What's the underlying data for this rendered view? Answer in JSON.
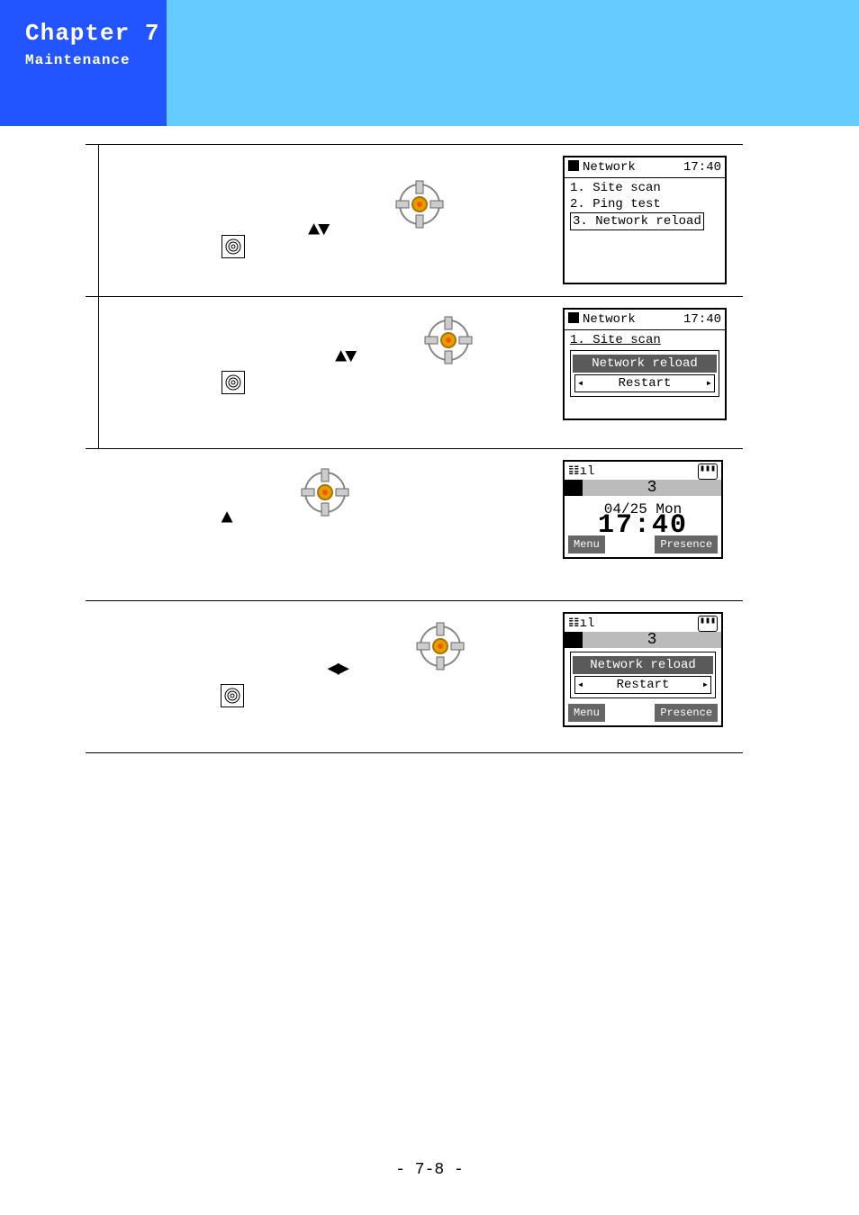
{
  "header": {
    "chapter": "Chapter 7",
    "subtitle": "Maintenance"
  },
  "footer": {
    "page_label": "- 7-8 -"
  },
  "rows": [
    {
      "arrows_glyph": "▲▼",
      "has_menu_key": true,
      "screen": {
        "type": "menu",
        "title": "Network",
        "time": "17:40",
        "items": [
          "1. Site scan",
          "2. Ping test",
          "3. Network reload"
        ],
        "selected_index": 2
      }
    },
    {
      "arrows_glyph": "▲▼",
      "has_menu_key": true,
      "screen": {
        "type": "confirm",
        "title": "Network",
        "time": "17:40",
        "header_item": "1. Site scan",
        "highlight": "Network reload",
        "nav_label": "Restart"
      }
    },
    {
      "arrows_glyph": "▲",
      "has_menu_key": false,
      "screen": {
        "type": "standby",
        "digit": "3",
        "date": "04/25 Mon",
        "time": "17:40",
        "soft_left": "Menu",
        "soft_right": "Presence"
      }
    },
    {
      "arrows_glyph": "◀▶",
      "has_menu_key": true,
      "screen": {
        "type": "standby_confirm",
        "digit": "3",
        "highlight": "Network reload",
        "nav_label": "Restart",
        "soft_left": "Menu",
        "soft_right": "Presence"
      }
    }
  ]
}
